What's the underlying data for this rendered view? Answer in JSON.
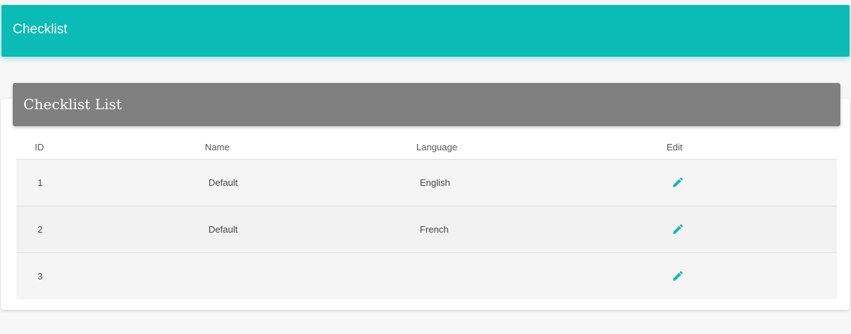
{
  "header": {
    "title": "Checklist"
  },
  "card": {
    "title": "Checklist List"
  },
  "table": {
    "columns": [
      "ID",
      "Name",
      "Language",
      "Edit"
    ],
    "rows": [
      {
        "id": "1",
        "name": "Default",
        "language": "English"
      },
      {
        "id": "2",
        "name": "Default",
        "language": "French"
      },
      {
        "id": "3",
        "name": "",
        "language": ""
      }
    ]
  },
  "icons": {
    "edit": "pencil-icon"
  },
  "colors": {
    "primary": "#0bbbb6",
    "card_header": "#808080"
  }
}
